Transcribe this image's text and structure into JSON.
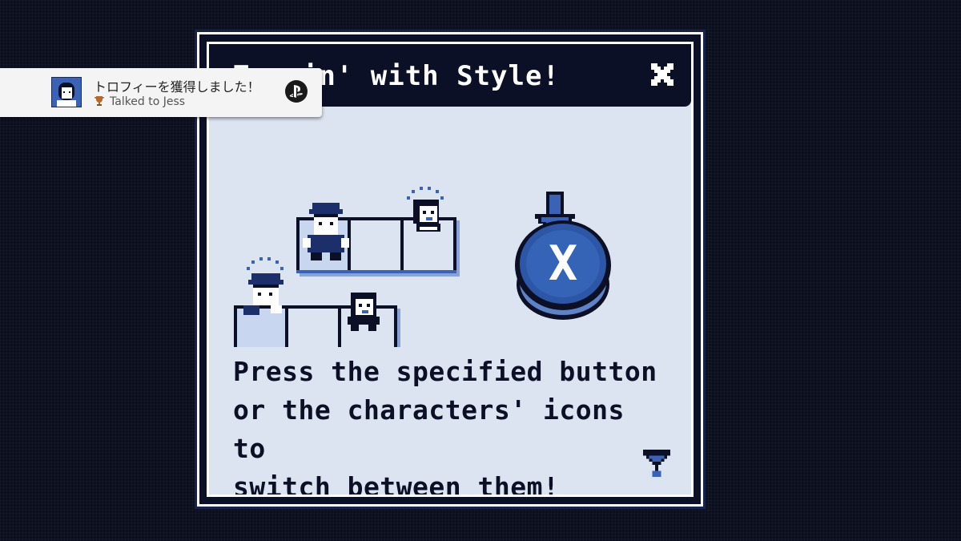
{
  "dialog": {
    "title": "Teamin' with Style!",
    "body_lines": [
      "Press the specified button",
      "or the characters' icons to",
      "switch between them!"
    ],
    "button_prompt_label": "X",
    "close_icon": "close-icon",
    "next_icon": "next-page-arrow-icon"
  },
  "notification": {
    "title": "トロフィーを獲得しました！",
    "trophy_name": "Talked to Jess",
    "trophy_icon": "trophy-icon",
    "platform_icon": "playstation-logo-icon"
  },
  "colors": {
    "background": "#0c0f1f",
    "panel": "#dde4f1",
    "title_bar": "#0c1026",
    "accent_blue": "#3b63b5",
    "button_blue": "#2d56a6"
  }
}
